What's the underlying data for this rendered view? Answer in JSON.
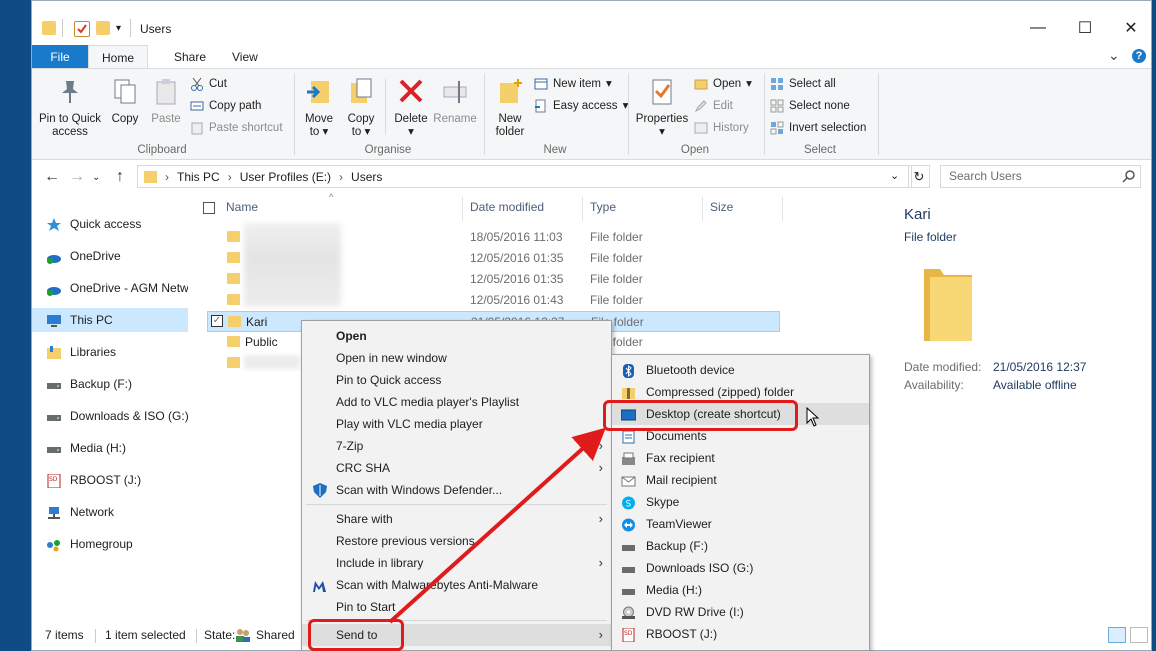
{
  "window": {
    "title": "Users",
    "minimize": "—",
    "maximize": "☐",
    "close": "✕"
  },
  "tabs": {
    "file": "File",
    "home": "Home",
    "share": "Share",
    "view": "View"
  },
  "ribbon": {
    "collapse": "⌄",
    "help": "?",
    "clipboard": {
      "label": "Clipboard",
      "pin": "Pin to Quick access",
      "copy": "Copy",
      "paste": "Paste",
      "cut": "Cut",
      "copy_path": "Copy path",
      "paste_shortcut": "Paste shortcut"
    },
    "organise": {
      "label": "Organise",
      "move_to": "Move to",
      "copy_to": "Copy to",
      "delete": "Delete",
      "rename": "Rename"
    },
    "new": {
      "label": "New",
      "new_folder": "New folder",
      "new_item": "New item",
      "easy_access": "Easy access"
    },
    "open": {
      "label": "Open",
      "properties": "Properties",
      "open": "Open",
      "edit": "Edit",
      "history": "History"
    },
    "select": {
      "label": "Select",
      "select_all": "Select all",
      "select_none": "Select none",
      "invert_selection": "Invert selection"
    }
  },
  "address": {
    "crumbs": [
      "This PC",
      "User Profiles (E:)",
      "Users"
    ],
    "search_placeholder": "Search Users"
  },
  "nav": [
    {
      "label": "Quick access",
      "icon": "star-icon"
    },
    {
      "label": "OneDrive",
      "icon": "cloud-icon"
    },
    {
      "label": "OneDrive - AGM Networks",
      "icon": "cloud-icon"
    },
    {
      "label": "This PC",
      "icon": "computer-icon"
    },
    {
      "label": "Libraries",
      "icon": "library-icon"
    },
    {
      "label": "Backup (F:)",
      "icon": "drive-icon"
    },
    {
      "label": "Downloads & ISO (G:)",
      "icon": "drive-icon"
    },
    {
      "label": "Media (H:)",
      "icon": "drive-icon"
    },
    {
      "label": "RBOOST (J:)",
      "icon": "sd-card-icon"
    },
    {
      "label": "Network",
      "icon": "network-icon"
    },
    {
      "label": "Homegroup",
      "icon": "homegroup-icon"
    }
  ],
  "columns": {
    "name": "Name",
    "date": "Date modified",
    "type": "Type",
    "size": "Size"
  },
  "files": [
    {
      "name": "",
      "date": "18/05/2016 11:03",
      "type": "File folder"
    },
    {
      "name": "",
      "date": "12/05/2016 01:35",
      "type": "File folder"
    },
    {
      "name": "",
      "date": "12/05/2016 01:35",
      "type": "File folder"
    },
    {
      "name": "",
      "date": "12/05/2016 01:43",
      "type": "File folder"
    },
    {
      "name": "Kari",
      "date": "21/05/2016 12:37",
      "type": "File folder"
    },
    {
      "name": "Public",
      "date": "",
      "type": "File folder"
    },
    {
      "name": "",
      "date": "",
      "type": ""
    }
  ],
  "details": {
    "name": "Kari",
    "type": "File folder",
    "date_label": "Date modified:",
    "date_value": "21/05/2016 12:37",
    "avail_label": "Availability:",
    "avail_value": "Available offline"
  },
  "status": {
    "items": "7 items",
    "selected": "1 item selected",
    "state_label": "State:",
    "state_value": "Shared"
  },
  "context_menu": [
    "Open",
    "Open in new window",
    "Pin to Quick access",
    "Add to VLC media player's Playlist",
    "Play with VLC media player",
    "7-Zip",
    "CRC SHA",
    "Scan with Windows Defender...",
    "Share with",
    "Restore previous versions",
    "Include in library",
    "Scan with Malwarebytes Anti-Malware",
    "Pin to Start",
    "Send to"
  ],
  "send_to": [
    {
      "label": "Bluetooth device",
      "icon": "bluetooth-icon"
    },
    {
      "label": "Compressed (zipped) folder",
      "icon": "zip-folder-icon"
    },
    {
      "label": "Desktop (create shortcut)",
      "icon": "desktop-icon"
    },
    {
      "label": "Documents",
      "icon": "documents-icon"
    },
    {
      "label": "Fax recipient",
      "icon": "fax-icon"
    },
    {
      "label": "Mail recipient",
      "icon": "mail-icon"
    },
    {
      "label": "Skype",
      "icon": "skype-icon"
    },
    {
      "label": "TeamViewer",
      "icon": "teamviewer-icon"
    },
    {
      "label": "Backup (F:)",
      "icon": "drive-icon"
    },
    {
      "label": "Downloads  ISO (G:)",
      "icon": "drive-icon"
    },
    {
      "label": "Media (H:)",
      "icon": "drive-icon"
    },
    {
      "label": "DVD RW Drive (I:)",
      "icon": "dvd-icon"
    },
    {
      "label": "RBOOST (J:)",
      "icon": "sd-card-icon"
    }
  ],
  "colors": {
    "accent": "#1979ca",
    "selection": "#cce8ff",
    "folder": "#f4cf6b",
    "highlight_red": "#e01b1b"
  }
}
